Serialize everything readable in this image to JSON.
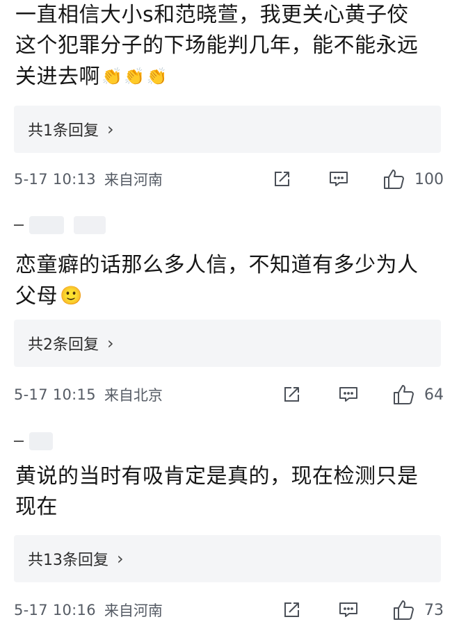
{
  "comments": [
    {
      "text_lines": [
        "一直相信大小s和范晓萱，我更关心黄子佼",
        "这个犯罪分子的下场能判几年，能不能永远",
        "关进去啊"
      ],
      "emojis": [
        "👏",
        "👏",
        "👏"
      ],
      "reply_link": "共1条回复",
      "time": "5-17 10:13",
      "location": "来自河南",
      "likes": "100"
    },
    {
      "text_lines": [
        "恋童癖的话那么多人信，不知道有多少为人",
        "父母"
      ],
      "emojis": [
        "🙂"
      ],
      "reply_link": "共2条回复",
      "time": "5-17 10:15",
      "location": "来自北京",
      "likes": "64"
    },
    {
      "text_lines": [
        "黄说的当时有吸肯定是真的，现在检测只是",
        "现在"
      ],
      "emojis": [],
      "reply_link": "共13条回复",
      "time": "5-17 10:16",
      "location": "来自河南",
      "likes": "73"
    }
  ],
  "icons": {
    "share": "share-icon",
    "comment": "comment-icon",
    "like": "thumbs-up-icon",
    "chevron": "›"
  },
  "colors": {
    "text": "#161616",
    "meta": "#555b64",
    "reply_bg": "#f4f5f7"
  }
}
